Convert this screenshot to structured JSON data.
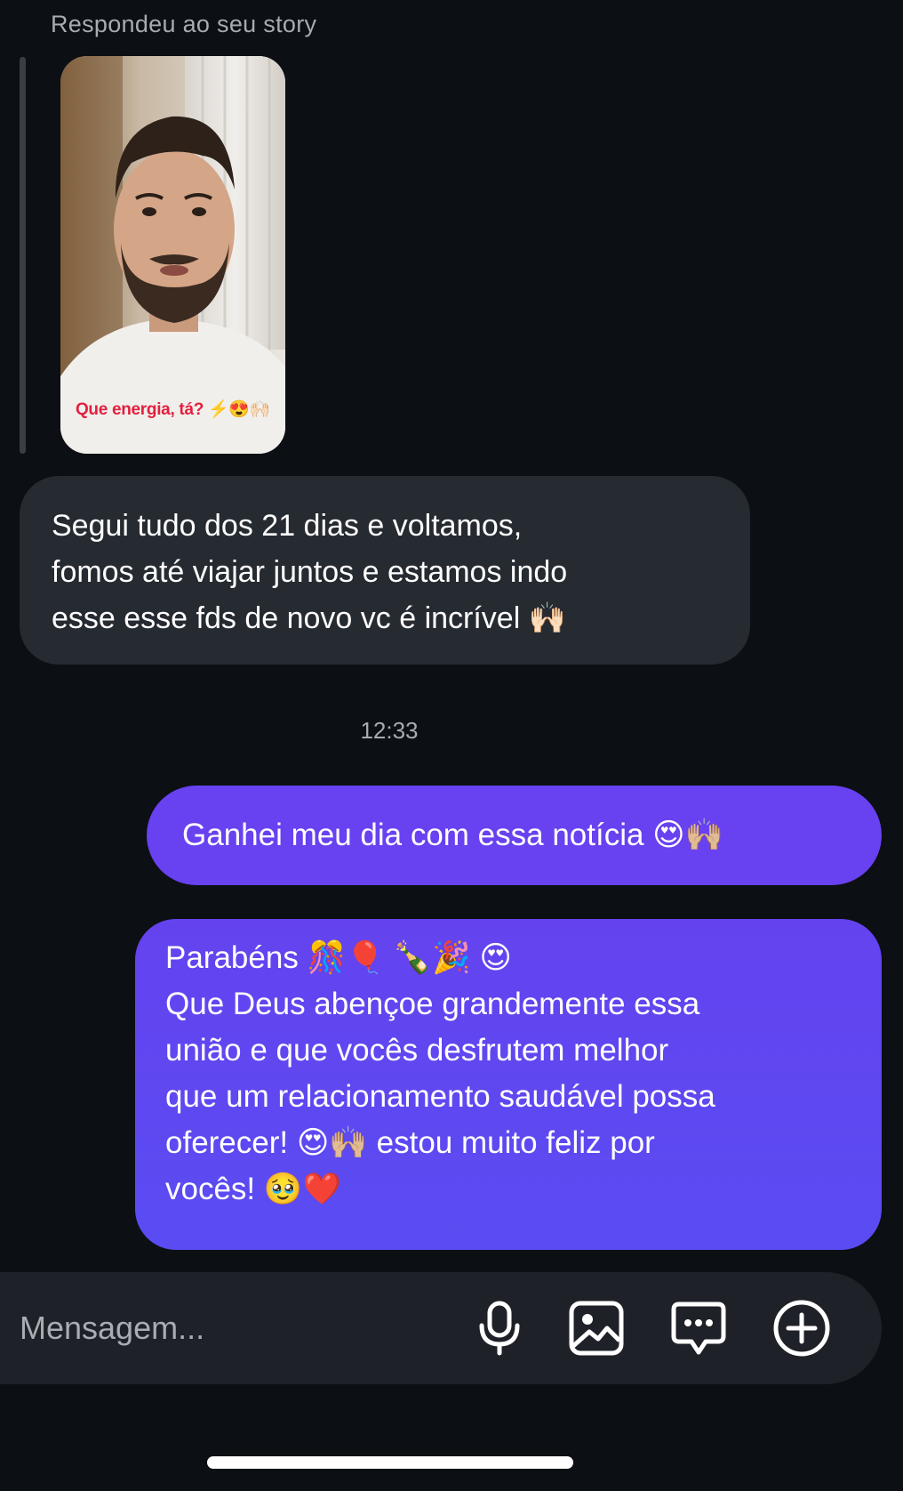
{
  "story_reply": {
    "caption": "Respondeu ao seu story",
    "story_overlay_text": "Que energia, tá? ⚡😍🙌🏻"
  },
  "messages": {
    "received": {
      "text": "Segui tudo dos 21 dias e voltamos,\nfomos até viajar juntos e estamos indo\nesse esse fds de novo  vc é incrível 🙌🏻"
    },
    "timestamp": "12:33",
    "sent_1": {
      "text": "Ganhei meu dia com essa notícia 😍🙌🏼"
    },
    "sent_2": {
      "text": "Parabéns 🎊🎈 🍾🎉 😍\nQue Deus abençoe grandemente essa\nunião e que vocês desfrutem melhor\nque um relacionamento saudável possa\noferecer! 😍🙌🏼 estou muito feliz por\nvocês! 🥹❤️"
    }
  },
  "composer": {
    "placeholder": "Mensagem...",
    "icons": [
      "microphone-icon",
      "image-icon",
      "chat-bubble-icon",
      "plus-circle-icon"
    ]
  },
  "colors": {
    "background": "#0c0f14",
    "received_bubble": "#262a31",
    "sent_bubble": "#6841f0",
    "composer": "#1e2127"
  }
}
